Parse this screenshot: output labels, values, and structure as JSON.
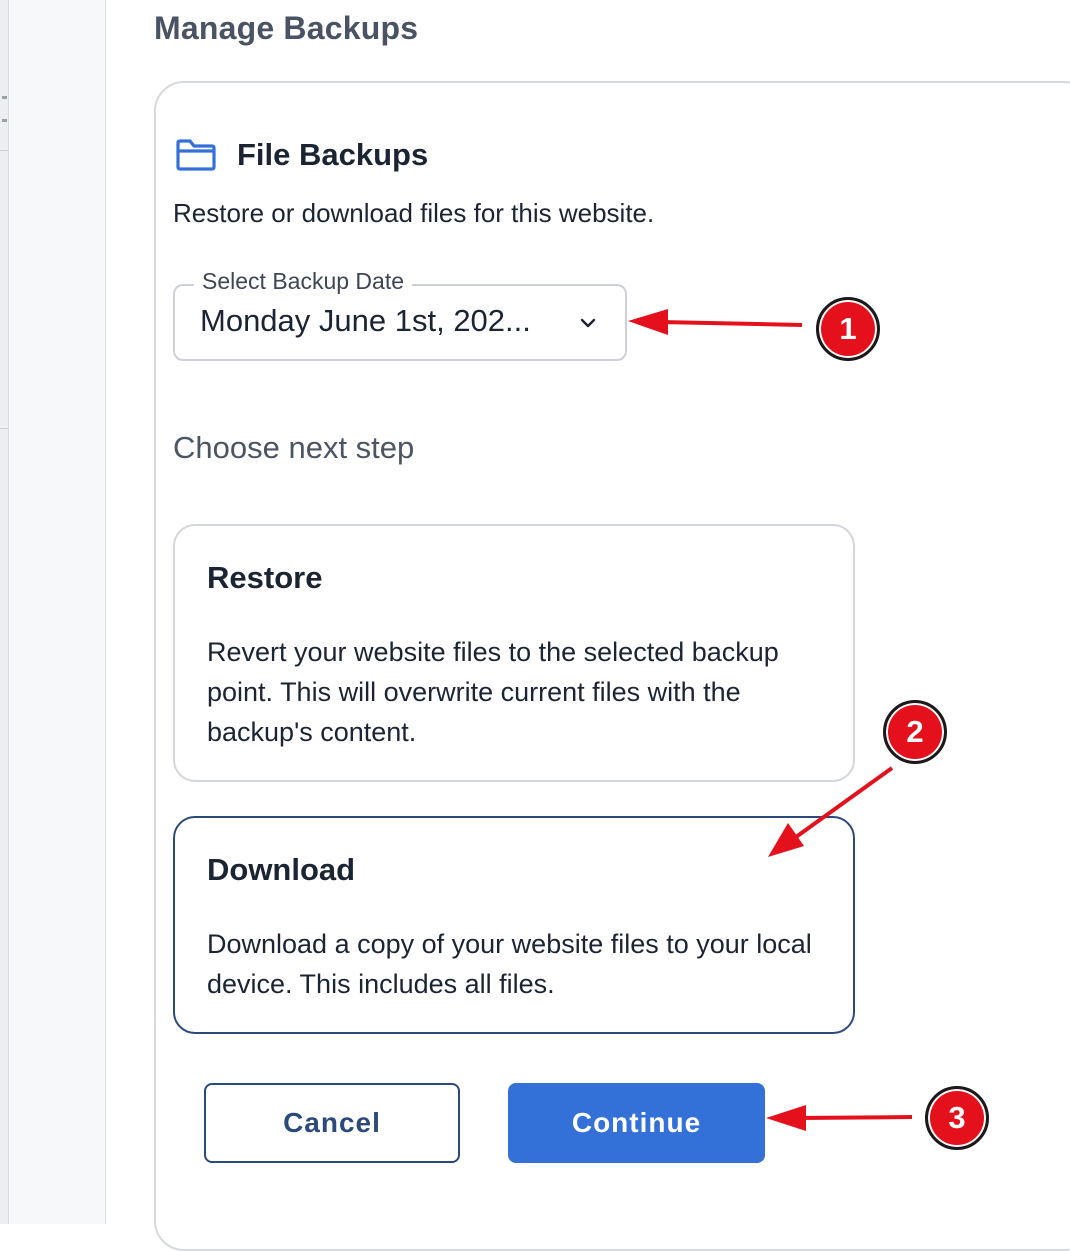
{
  "page": {
    "title": "Manage Backups"
  },
  "file_backups": {
    "title": "File Backups",
    "icon": "folder-icon",
    "description": "Restore or download files for this website.",
    "select": {
      "label": "Select Backup Date",
      "value": "Monday June 1st, 202...",
      "icon": "chevron-down-icon"
    },
    "next_step_label": "Choose next step",
    "options": [
      {
        "title": "Restore",
        "description": "Revert your website files to the selected backup point. This will overwrite current files with the backup's content."
      },
      {
        "title": "Download",
        "description": "Download a copy of your website files to your local device. This includes all files."
      }
    ],
    "buttons": {
      "cancel": "Cancel",
      "continue": "Continue"
    }
  },
  "annotations": [
    {
      "label": "1"
    },
    {
      "label": "2"
    },
    {
      "label": "3"
    }
  ],
  "colors": {
    "accent": "#3371d8",
    "selected_border": "#2b4a7a",
    "annotation": "#e4101c"
  }
}
